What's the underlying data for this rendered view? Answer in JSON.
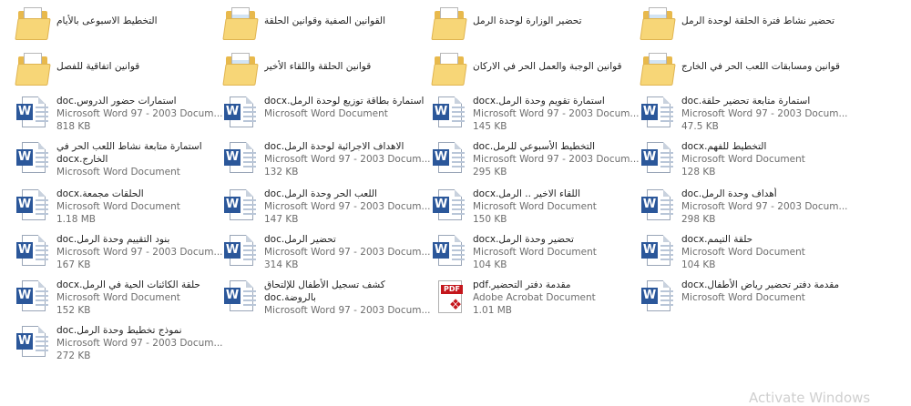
{
  "items": [
    {
      "kind": "folder",
      "name": "التخطيط الاسبوعى بالأيام",
      "line2": "",
      "line3": ""
    },
    {
      "kind": "folder",
      "name": "القوانين الصفية وقوانين الحلقة",
      "line2": "",
      "line3": ""
    },
    {
      "kind": "folder",
      "name": "تحضير الوزارة لوحدة الرمل",
      "line2": "",
      "line3": ""
    },
    {
      "kind": "folder",
      "name": "تحضير نشاط فترة الحلقة لوحدة الرمل",
      "line2": "",
      "line3": ""
    },
    {
      "kind": "folder",
      "name": "قوانين اتفاقية للفصل",
      "line2": "",
      "line3": ""
    },
    {
      "kind": "folder",
      "name": "قوانين الحلقة واللقاء الأخير",
      "line2": "",
      "line3": ""
    },
    {
      "kind": "folder",
      "name": "قوانين الوجبة والعمل الحر في الاركان",
      "line2": "",
      "line3": ""
    },
    {
      "kind": "folder",
      "name": "قوانين ومسابقات اللعب الحر في الخارج",
      "line2": "",
      "line3": ""
    },
    {
      "kind": "word",
      "name": "استمارات حضور الدروس.doc",
      "line2": "Microsoft Word 97 - 2003 Docum...",
      "line3": "818 KB"
    },
    {
      "kind": "word",
      "name": "استمارة بطاقة توزيع لوحدة الرمل.docx",
      "line2": "Microsoft Word Document",
      "line3": ""
    },
    {
      "kind": "word",
      "name": "استمارة تقويم وحدة الرمل.docx",
      "line2": "Microsoft Word 97 - 2003 Docum...",
      "line3": "145 KB"
    },
    {
      "kind": "word",
      "name": "استمارة متابعة تحضير حلقة.doc",
      "line2": "Microsoft Word 97 - 2003 Docum...",
      "line3": "47.5 KB"
    },
    {
      "kind": "word",
      "name": "استمارة متابعة نشاط اللعب الحر في الخارج.docx",
      "line2": "Microsoft Word Document",
      "line3": ""
    },
    {
      "kind": "word",
      "name": "الاهداف الاجرائية لوحدة الرمل.doc",
      "line2": "Microsoft Word 97 - 2003 Docum...",
      "line3": "132 KB"
    },
    {
      "kind": "word",
      "name": "التخطيط الأسبوعي للرمل.doc",
      "line2": "Microsoft Word 97 - 2003 Docum...",
      "line3": "295 KB"
    },
    {
      "kind": "word",
      "name": "التخطيط للفهم.docx",
      "line2": "Microsoft Word Document",
      "line3": "128 KB"
    },
    {
      "kind": "word",
      "name": "الحلقات مجمعة.docx",
      "line2": "Microsoft Word Document",
      "line3": "1.18 MB"
    },
    {
      "kind": "word",
      "name": "اللعب الحر وحدة الرمل.doc",
      "line2": "Microsoft Word 97 - 2003 Docum...",
      "line3": "147 KB"
    },
    {
      "kind": "word",
      "name": "اللقاء الاخير .. الرمل.docx",
      "line2": "Microsoft Word Document",
      "line3": "150 KB"
    },
    {
      "kind": "word",
      "name": "أهداف وحدة الرمل.doc",
      "line2": "Microsoft Word 97 - 2003 Docum...",
      "line3": "298 KB"
    },
    {
      "kind": "word",
      "name": "بنود التقييم وحدة الرمل.doc",
      "line2": "Microsoft Word 97 - 2003 Docum...",
      "line3": "167 KB"
    },
    {
      "kind": "word",
      "name": "تحضير الرمل.doc",
      "line2": "Microsoft Word 97 - 2003 Docum...",
      "line3": "314 KB"
    },
    {
      "kind": "word",
      "name": "تحضير وحدة الرمل.docx",
      "line2": "Microsoft Word Document",
      "line3": "104 KB"
    },
    {
      "kind": "word",
      "name": "حلقة التيمم.docx",
      "line2": "Microsoft Word Document",
      "line3": "104 KB"
    },
    {
      "kind": "word",
      "name": "حلقة الكائنات الحية في الرمل.docx",
      "line2": "Microsoft Word Document",
      "line3": "152 KB"
    },
    {
      "kind": "word",
      "name": "كشف تسجيل الأطفال للإلتحاق بالروضة.doc",
      "line2": "Microsoft Word 97 - 2003 Docum...",
      "line3": ""
    },
    {
      "kind": "pdf",
      "name": "مقدمة دفتر التحضير.pdf",
      "line2": "Adobe Acrobat Document",
      "line3": "1.01 MB"
    },
    {
      "kind": "word",
      "name": "مقدمة دفتر تحضير رياض الأطفال.docx",
      "line2": "Microsoft Word Document",
      "line3": ""
    },
    {
      "kind": "word",
      "name": "نموذج تخطيط وحدة الرمل.doc",
      "line2": "Microsoft Word 97 - 2003 Docum...",
      "line3": "272 KB"
    }
  ],
  "watermark": "Activate Windows",
  "colors": {
    "word": "#2b579a",
    "pdf": "#c4161c",
    "folder": "#f7d677"
  }
}
